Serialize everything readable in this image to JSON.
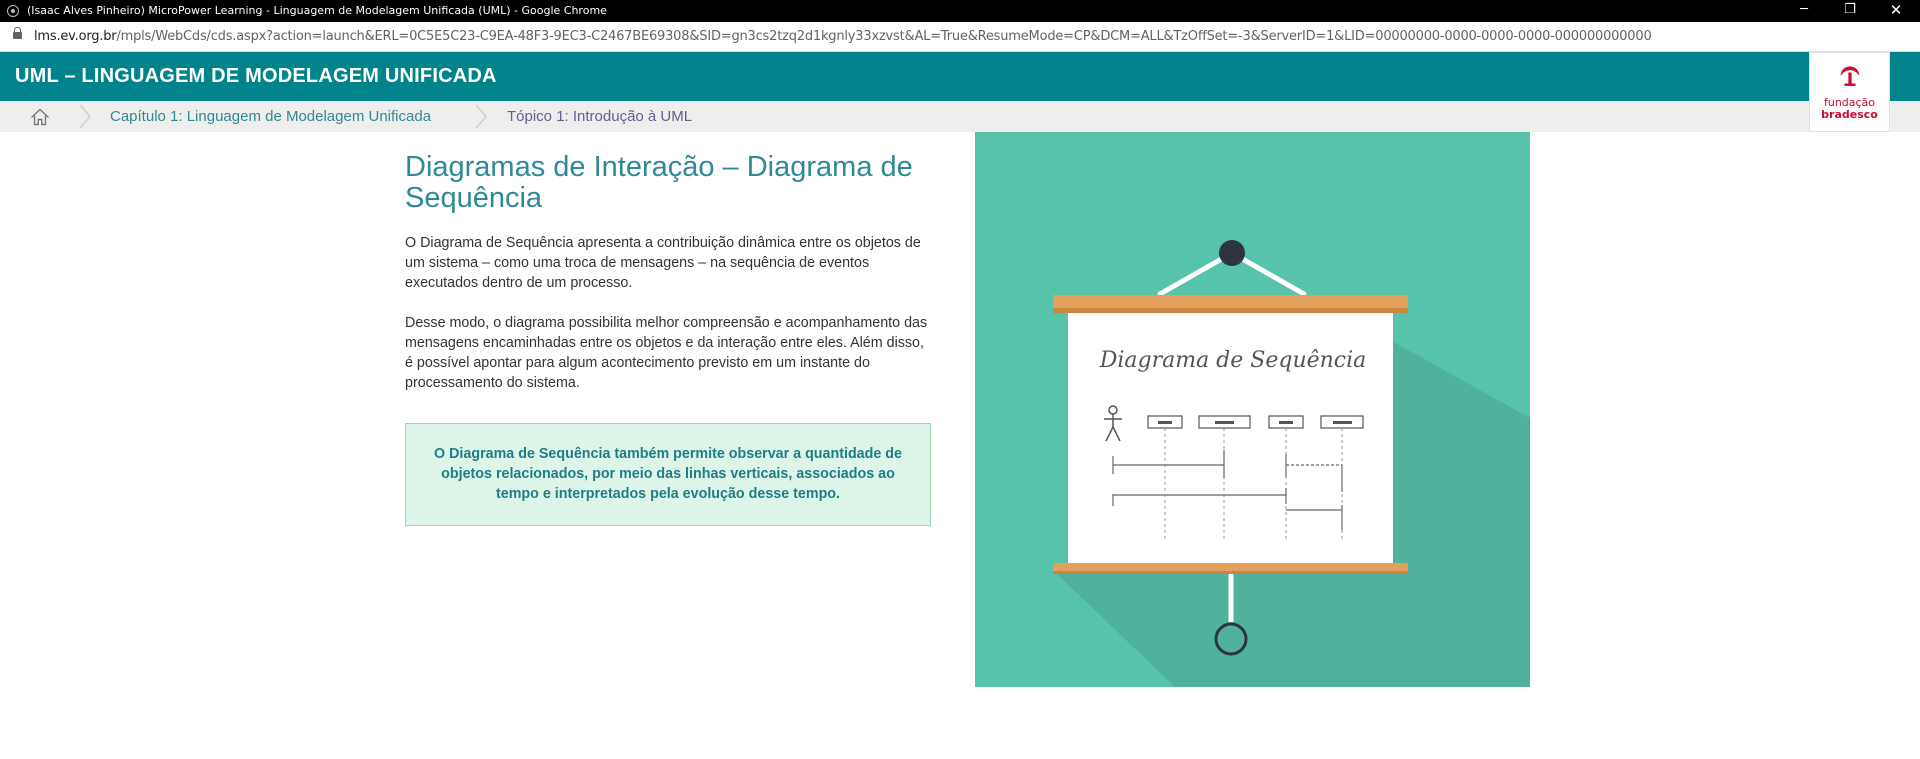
{
  "window": {
    "title": "(Isaac Alves Pinheiro) MicroPower Learning - Linguagem de Modelagem Unificada (UML) - Google Chrome",
    "controls": {
      "minimize": "─",
      "restore": "❐",
      "close": "✕"
    }
  },
  "address_bar": {
    "url_host": "lms.ev.org.br",
    "url_path": "/mpls/WebCds/cds.aspx?action=launch&ERL=0C5E5C23-C9EA-48F3-9EC3-C2467BE69308&SID=gn3cs2tzq2d1kgnly33xzvst&AL=True&ResumeMode=CP&DCM=ALL&TzOffSet=-3&ServerID=1&LID=00000000-0000-0000-0000-000000000000"
  },
  "header": {
    "course_title": "UML – LINGUAGEM DE MODELAGEM UNIFICADA"
  },
  "logo": {
    "line1": "fundação",
    "line2": "bradesco"
  },
  "breadcrumb": {
    "home_icon": "home-icon",
    "chapter": "Capítulo 1: Linguagem de Modelagem Unificada",
    "topic": "Tópico 1: Introdução à UML"
  },
  "content": {
    "title": "Diagramas de Interação – Diagrama de Sequência",
    "paragraph1": "O Diagrama de Sequência apresenta a contribuição dinâmica entre os objetos de um sistema – como uma troca de mensagens – na sequência de eventos executados dentro de um processo.",
    "paragraph2": "Desse modo, o diagrama possibilita melhor compreensão e acompanhamento das mensagens encaminhadas entre os objetos e da interação entre eles. Além disso, é possível apontar para algum acontecimento previsto em um instante do processamento do sistema.",
    "callout": "O Diagrama de Sequência também permite observar a quantidade de objetos relacionados, por meio das linhas verticais, associados ao tempo e interpretados pela evolução desse tempo."
  },
  "illustration": {
    "board_title": "Diagrama de Sequência"
  },
  "colors": {
    "header_teal": "#00838b",
    "illustration_bg": "#57c3ab",
    "board_wood": "#e2a05c",
    "callout_bg": "#ddf5e9",
    "logo_red": "#cc092f"
  }
}
